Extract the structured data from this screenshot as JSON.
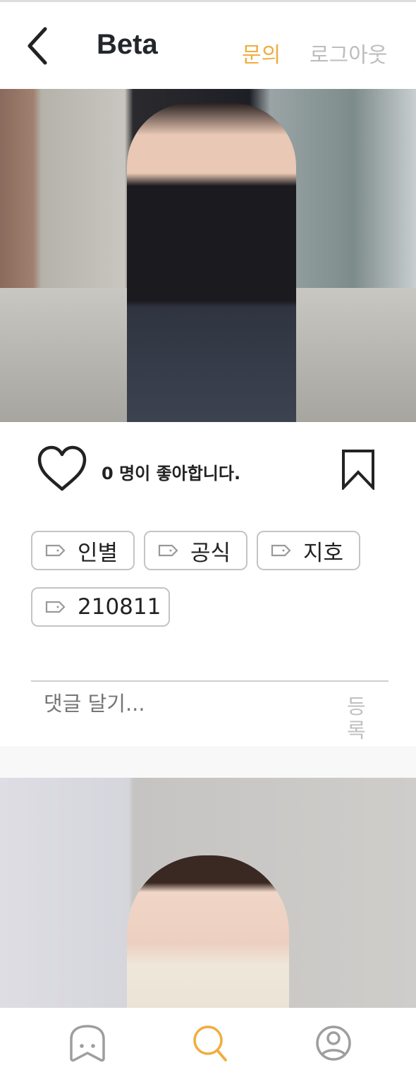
{
  "header": {
    "title": "Beta",
    "inquiry_label": "문의",
    "logout_label": "로그아웃"
  },
  "post": {
    "likes_text": "0 명이 좋아합니다.",
    "tags": [
      "인별",
      "공식",
      "지호",
      "210811"
    ],
    "comment_placeholder": "댓글 달기...",
    "submit_label": "등록"
  },
  "nav": {
    "items": [
      "ghost-icon",
      "search-icon",
      "profile-icon"
    ],
    "active": "search-icon"
  },
  "colors": {
    "accent": "#f0ad3d",
    "inactive": "#9e9e9e",
    "text": "#23262b"
  }
}
